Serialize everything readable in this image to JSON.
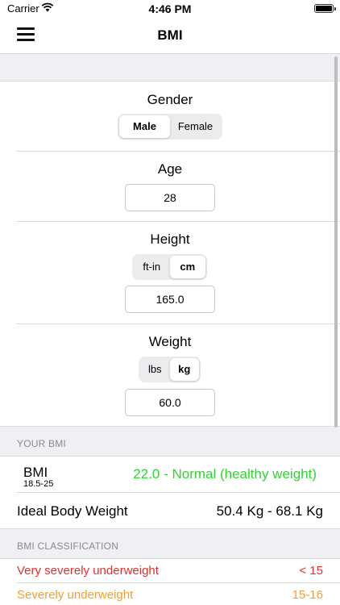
{
  "status_bar": {
    "carrier": "Carrier",
    "time": "4:46 PM"
  },
  "nav": {
    "title": "BMI"
  },
  "gender": {
    "label": "Gender",
    "options": [
      "Male",
      "Female"
    ],
    "selected": "Male"
  },
  "age": {
    "label": "Age",
    "value": "28"
  },
  "height": {
    "label": "Height",
    "units": [
      "ft-in",
      "cm"
    ],
    "selected_unit": "cm",
    "value": "165.0"
  },
  "weight": {
    "label": "Weight",
    "units": [
      "lbs",
      "kg"
    ],
    "selected_unit": "kg",
    "value": "60.0"
  },
  "your_bmi": {
    "header": "YOUR BMI",
    "bmi_label": "BMI",
    "bmi_range": "18.5-25",
    "bmi_result": "22.0 - Normal (healthy weight)",
    "ideal_label": "Ideal Body Weight",
    "ideal_value": "50.4 Kg - 68.1 Kg"
  },
  "classification": {
    "header": "BMI CLASSIFICATION",
    "rows": [
      {
        "label": "Very severely underweight",
        "value": "< 15",
        "color": "#e0332e"
      },
      {
        "label": "Severely underweight",
        "value": "15-16",
        "color": "#f0a030"
      }
    ]
  },
  "colors": {
    "normal": "#2fd431",
    "very_severe": "#e0332e",
    "severe": "#f0a030"
  }
}
